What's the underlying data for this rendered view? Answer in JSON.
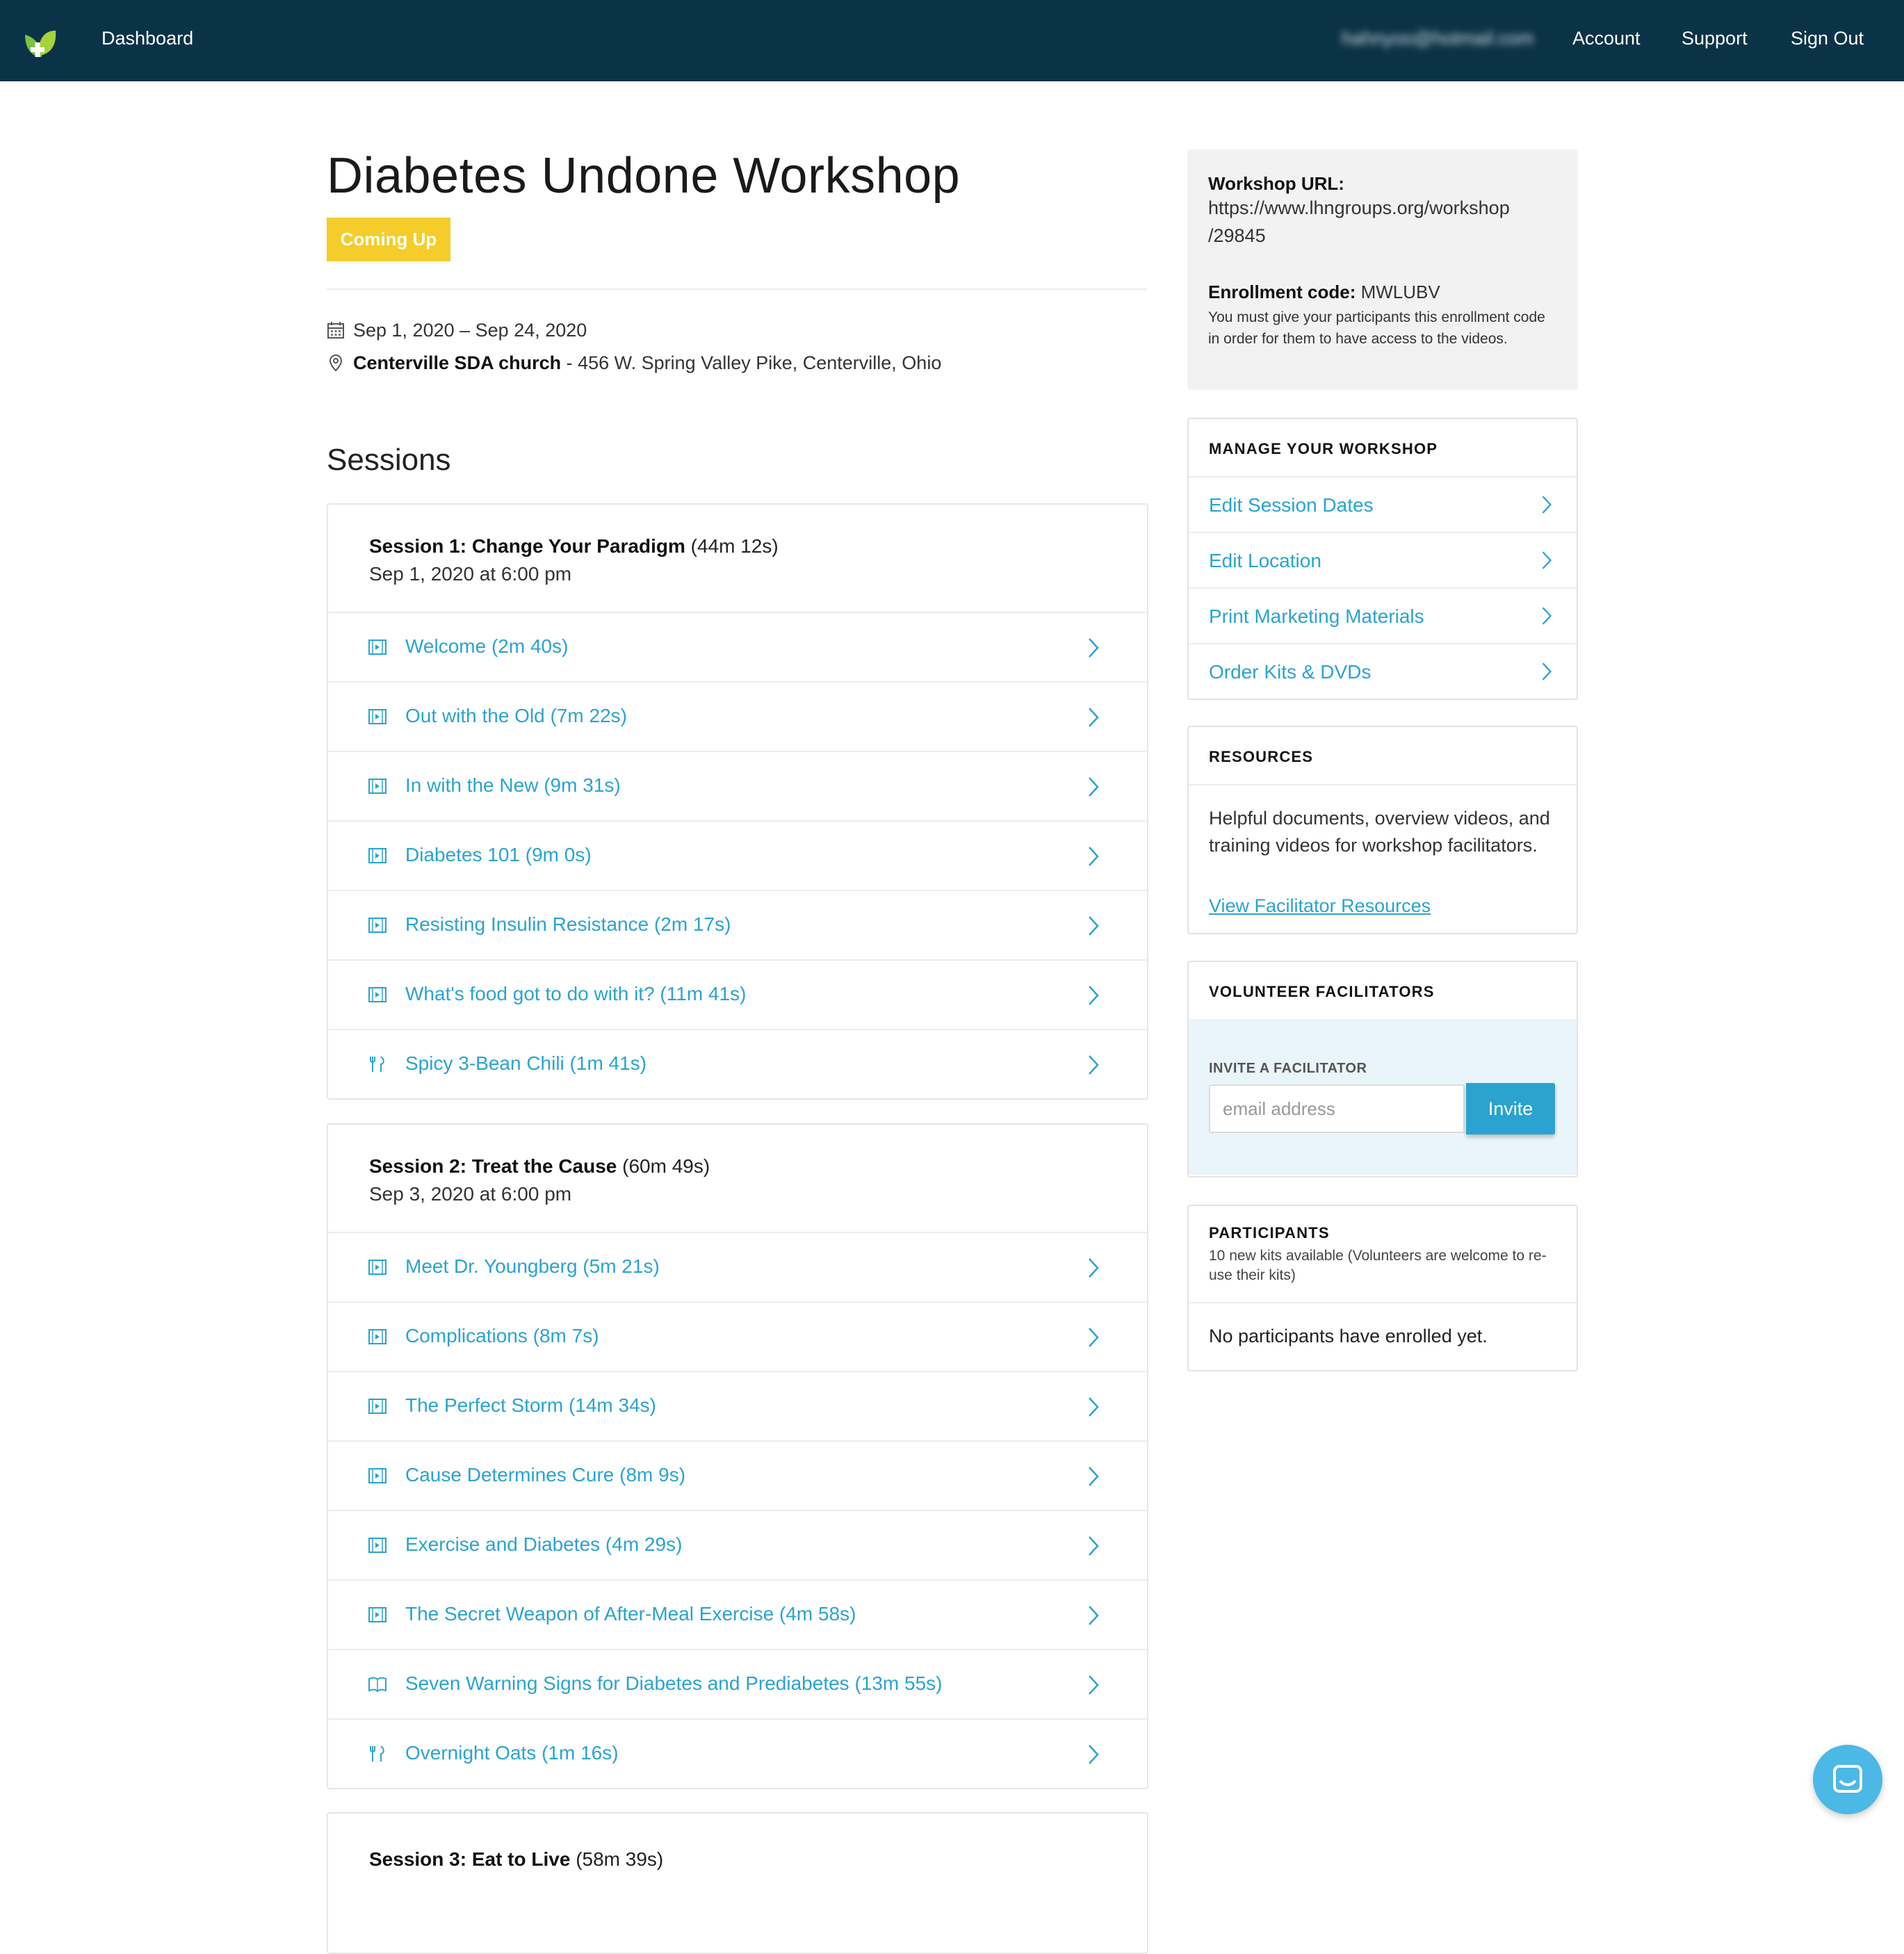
{
  "nav": {
    "dashboard": "Dashboard",
    "email": "hahnyoo@hotmail.com",
    "account": "Account",
    "support": "Support",
    "signout": "Sign Out",
    "bg_color": "#0b3347"
  },
  "workshop": {
    "title": "Diabetes Undone Workshop",
    "status": "Coming Up",
    "dates": "Sep 1, 2020 – Sep 24, 2020",
    "location_name": "Centerville SDA church",
    "location_address": " - 456 W. Spring Valley Pike, Centerville, Ohio"
  },
  "sessions_heading": "Sessions",
  "sessions": [
    {
      "title": "Session 1: Change Your Paradigm",
      "duration": "(44m 12s)",
      "date": "Sep 1, 2020 at 6:00 pm",
      "items": [
        {
          "label": "Welcome (2m 40s)",
          "icon": "video-icon"
        },
        {
          "label": "Out with the Old (7m 22s)",
          "icon": "video-icon"
        },
        {
          "label": "In with the New (9m 31s)",
          "icon": "video-icon"
        },
        {
          "label": "Diabetes 101 (9m 0s)",
          "icon": "video-icon"
        },
        {
          "label": "Resisting Insulin Resistance (2m 17s)",
          "icon": "video-icon"
        },
        {
          "label": "What's food got to do with it? (11m 41s)",
          "icon": "video-icon"
        },
        {
          "label": "Spicy 3-Bean Chili (1m 41s)",
          "icon": "utensils-icon"
        }
      ]
    },
    {
      "title": "Session 2: Treat the Cause",
      "duration": "(60m 49s)",
      "date": "Sep 3, 2020 at 6:00 pm",
      "items": [
        {
          "label": "Meet Dr. Youngberg (5m 21s)",
          "icon": "video-icon"
        },
        {
          "label": "Complications (8m 7s)",
          "icon": "video-icon"
        },
        {
          "label": "The Perfect Storm (14m 34s)",
          "icon": "video-icon"
        },
        {
          "label": "Cause Determines Cure (8m 9s)",
          "icon": "video-icon"
        },
        {
          "label": "Exercise and Diabetes (4m 29s)",
          "icon": "video-icon"
        },
        {
          "label": "The Secret Weapon of After-Meal Exercise (4m 58s)",
          "icon": "video-icon"
        },
        {
          "label": "Seven Warning Signs for Diabetes and Prediabetes (13m 55s)",
          "icon": "book-icon"
        },
        {
          "label": "Overnight Oats (1m 16s)",
          "icon": "utensils-icon"
        }
      ]
    },
    {
      "title": "Session 3: Eat to Live",
      "duration": "(58m 39s)",
      "date": "",
      "items": []
    }
  ],
  "sidebar": {
    "url_label": "Workshop URL:",
    "url_line1": "https://www.lhngroups.org/workshop",
    "url_line2": "/29845",
    "enroll_label": "Enrollment code:",
    "enroll_code": " MWLUBV",
    "enroll_note": "You must give your participants this enrollment code in order for them to have access to the videos.",
    "manage_heading": "MANAGE YOUR WORKSHOP",
    "manage_items": [
      "Edit Session Dates",
      "Edit Location",
      "Print Marketing Materials",
      "Order Kits & DVDs"
    ],
    "resources_heading": "RESOURCES",
    "resources_text": "Helpful documents, overview videos, and training videos for workshop facilitators.",
    "resources_link": "View Facilitator Resources",
    "volunteers_heading": "VOLUNTEER FACILITATORS",
    "invite_label": "INVITE A FACILITATOR",
    "invite_placeholder": "email address",
    "invite_button": "Invite",
    "participants_heading": "PARTICIPANTS",
    "participants_sub": "10 new kits available (Volunteers are welcome to re-use their kits)",
    "participants_empty": "No participants have enrolled yet."
  },
  "colors": {
    "accent": "#2aa3d0",
    "badge": "#f4cd2a",
    "navbar": "#0b3347"
  }
}
